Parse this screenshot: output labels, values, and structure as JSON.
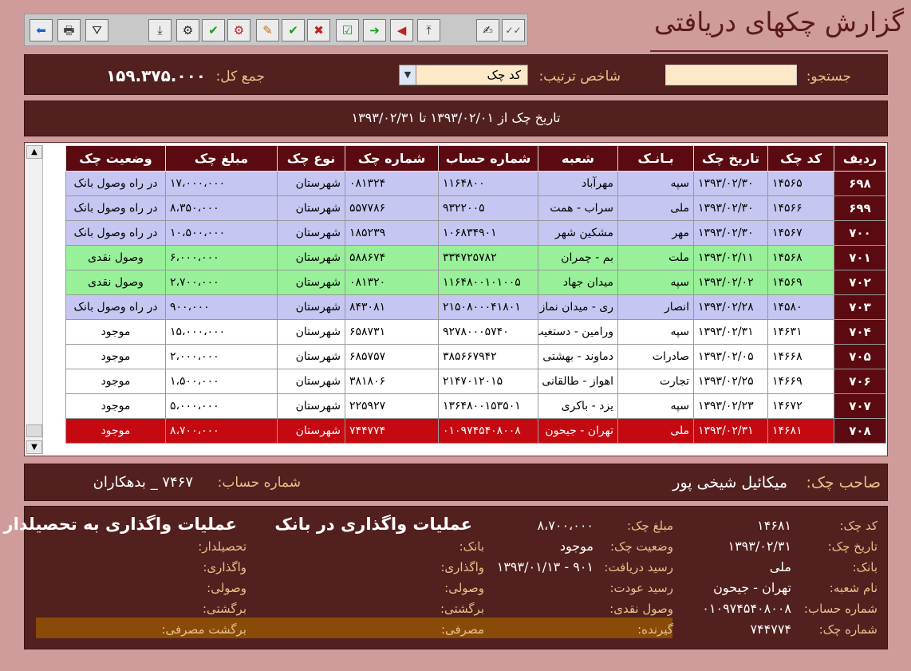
{
  "window": {
    "title": "گزارش چکهای دریافتی"
  },
  "toolbar": {
    "icons": [
      "arrow-left-icon",
      "print-icon",
      "filter-icon",
      "import-icon",
      "gear-icon",
      "check-green-icon",
      "gear-red-icon",
      "user-edit-icon",
      "check-pen-icon",
      "cancel-pen-icon",
      "checkbox-icon",
      "arrow-right-green-icon",
      "arrow-left-red-icon",
      "export-icon",
      "signature-icon",
      "double-check-icon"
    ],
    "glyphs": [
      "⬅",
      "🖶",
      "⛛",
      "⤓",
      "⚙",
      "✔",
      "⚙",
      "✎",
      "✔",
      "✖",
      "☑",
      "➔",
      "◀",
      "⤒",
      "✍",
      "✓✓"
    ]
  },
  "filters": {
    "search_label": "جستجو:",
    "search_value": "",
    "sort_label": "شاخص ترتیب:",
    "sort_value": "کد چک",
    "total_label": "جمع کل:",
    "total_value": "۱۵۹.۳۷۵.۰۰۰"
  },
  "date_range": "تاریخ چک از ۱۳۹۳/۰۲/۰۱ تا ۱۳۹۳/۰۲/۳۱",
  "table": {
    "headers": [
      "ردیف",
      "کد چک",
      "تاریخ چک",
      "بـانـک",
      "شعبه",
      "شماره حساب",
      "شماره چک",
      "نوع چک",
      "مبلغ چک",
      "وضعیت چک"
    ],
    "rows": [
      {
        "style": "blue",
        "cells": [
          "۶۹۸",
          "۱۴۵۶۵",
          "۱۳۹۳/۰۲/۳۰",
          "سپه",
          "مهرآباد",
          "۱۱۶۴۸۰۰",
          "۰۸۱۳۲۴",
          "شهرستان",
          "۱۷،۰۰۰،۰۰۰",
          "در راه وصول بانک"
        ]
      },
      {
        "style": "blue",
        "cells": [
          "۶۹۹",
          "۱۴۵۶۶",
          "۱۳۹۳/۰۲/۳۰",
          "ملی",
          "سراب - همت",
          "۹۳۲۲۰۰۵",
          "۵۵۷۷۸۶",
          "شهرستان",
          "۸،۳۵۰،۰۰۰",
          "در راه وصول بانک"
        ]
      },
      {
        "style": "blue",
        "cells": [
          "۷۰۰",
          "۱۴۵۶۷",
          "۱۳۹۳/۰۲/۳۰",
          "مهر",
          "مشکین شهر",
          "۱۰۶۸۳۴۹۰۱",
          "۱۸۵۲۳۹",
          "شهرستان",
          "۱۰،۵۰۰،۰۰۰",
          "در راه وصول بانک"
        ]
      },
      {
        "style": "green",
        "cells": [
          "۷۰۱",
          "۱۴۵۶۸",
          "۱۳۹۳/۰۲/۱۱",
          "ملت",
          "بم - چمران",
          "۳۳۴۷۲۵۷۸۲",
          "۵۸۸۶۷۴",
          "شهرستان",
          "۶،۰۰۰،۰۰۰",
          "وصول نقدی"
        ]
      },
      {
        "style": "green",
        "cells": [
          "۷۰۲",
          "۱۴۵۶۹",
          "۱۳۹۳/۰۲/۰۲",
          "سپه",
          "میدان جهاد",
          "۱۱۶۴۸۰۰۱۰۱۰۰۵",
          "۰۸۱۳۲۰",
          "شهرستان",
          "۲،۷۰۰،۰۰۰",
          "وصول نقدی"
        ]
      },
      {
        "style": "blue",
        "cells": [
          "۷۰۳",
          "۱۴۵۸۰",
          "۱۳۹۳/۰۲/۲۸",
          "انصار",
          "ری - میدان نماز",
          "۲۱۵۰۸۰۰۰۴۱۸۰۱",
          "۸۴۳۰۸۱",
          "شهرستان",
          "۹۰۰،۰۰۰",
          "در راه وصول بانک"
        ]
      },
      {
        "style": "white",
        "cells": [
          "۷۰۴",
          "۱۴۶۳۱",
          "۱۳۹۳/۰۲/۳۱",
          "سپه",
          "ورامین - دستغیب",
          "۹۲۷۸۰۰۰۵۷۴۰",
          "۶۵۸۷۳۱",
          "شهرستان",
          "۱۵،۰۰۰،۰۰۰",
          "موجود"
        ]
      },
      {
        "style": "white",
        "cells": [
          "۷۰۵",
          "۱۴۶۶۸",
          "۱۳۹۳/۰۲/۰۵",
          "صادرات",
          "دماوند - بهشتی",
          "۳۸۵۶۶۷۹۴۲",
          "۶۸۵۷۵۷",
          "شهرستان",
          "۲،۰۰۰،۰۰۰",
          "موجود"
        ]
      },
      {
        "style": "white",
        "cells": [
          "۷۰۶",
          "۱۴۶۶۹",
          "۱۳۹۳/۰۲/۲۵",
          "تجارت",
          "اهواز - طالقانی",
          "۲۱۴۷۰۱۲۰۱۵",
          "۳۸۱۸۰۶",
          "شهرستان",
          "۱،۵۰۰،۰۰۰",
          "موجود"
        ]
      },
      {
        "style": "white",
        "cells": [
          "۷۰۷",
          "۱۴۶۷۲",
          "۱۳۹۳/۰۲/۲۳",
          "سپه",
          "یزد - باکری",
          "۱۳۶۴۸۰۰۱۵۳۵۰۱",
          "۲۲۵۹۲۷",
          "شهرستان",
          "۵،۰۰۰،۰۰۰",
          "موجود"
        ]
      },
      {
        "style": "red",
        "cells": [
          "۷۰۸",
          "۱۴۶۸۱",
          "۱۳۹۳/۰۲/۳۱",
          "ملی",
          "تهران - جیحون",
          "۰۱۰۹۷۴۵۴۰۸۰۰۸",
          "۷۴۴۷۷۴",
          "شهرستان",
          "۸،۷۰۰،۰۰۰",
          "موجود"
        ]
      }
    ]
  },
  "owner": {
    "label": "صاحب چک:",
    "value": "میکائیل شیخی پور",
    "account_label": "شماره حساب:",
    "account_value": "۷۴۶۷ _ بدهکاران"
  },
  "detail": {
    "col1": [
      {
        "label": "کد چک:",
        "value": "۱۴۶۸۱"
      },
      {
        "label": "تاریخ چک:",
        "value": "۱۳۹۳/۰۲/۳۱"
      },
      {
        "label": "بانک:",
        "value": "ملی"
      },
      {
        "label": "نام شعبه:",
        "value": "تهران - جیحون"
      },
      {
        "label": "شماره حساب:",
        "value": "۰۱۰۹۷۴۵۴۰۸۰۰۸"
      },
      {
        "label": "شماره چک:",
        "value": "۷۴۴۷۷۴"
      }
    ],
    "col2": [
      {
        "label": "مبلغ چک:",
        "value": "۸،۷۰۰،۰۰۰"
      },
      {
        "label": "وضعیت چک:",
        "value": "موجود"
      },
      {
        "label": "رسید دریافت:",
        "value": "۹۰۱ - ۱۳۹۳/۰۱/۱۳"
      },
      {
        "label": "رسید عودت:",
        "value": ""
      },
      {
        "label": "وصول نقدی:",
        "value": ""
      },
      {
        "label": "گیرنده:",
        "value": ""
      }
    ],
    "bank_ops_title": "عملیات واگذاری در بانک",
    "col3": [
      "بانک:",
      "واگذاری:",
      "وصولی:",
      "برگشتی:",
      "مصرفی:"
    ],
    "collector_ops_title": "عملیات واگذاری به تحصیلدار",
    "col4": [
      "تحصیلدار:",
      "واگذاری:",
      "وصولی:",
      "برگشتی:",
      "برگشت مصرفی:"
    ]
  }
}
